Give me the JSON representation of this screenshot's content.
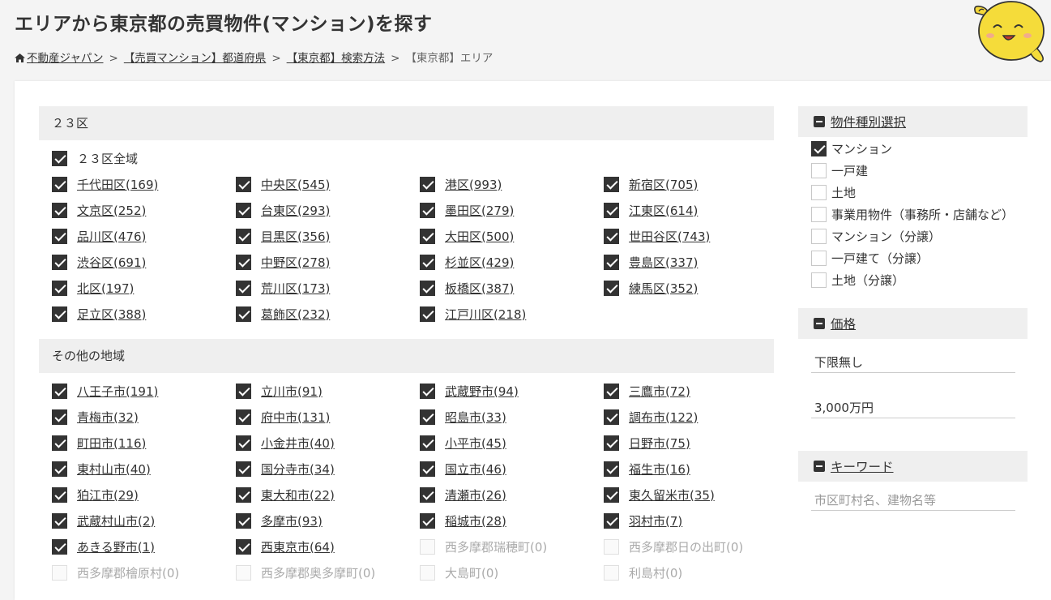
{
  "page": {
    "title": "エリアから東京都の売買物件(マンション)を探す"
  },
  "breadcrumb": {
    "items": [
      "不動産ジャパン",
      "【売買マンション】都道府県",
      "【東京都】検索方法"
    ],
    "current": "【東京都】エリア",
    "separator": ">"
  },
  "sections": {
    "wards": {
      "title": "２３区",
      "all_label": "２３区全域",
      "items": [
        {
          "label": "千代田区(169)",
          "checked": true
        },
        {
          "label": "中央区(545)",
          "checked": true
        },
        {
          "label": "港区(993)",
          "checked": true
        },
        {
          "label": "新宿区(705)",
          "checked": true
        },
        {
          "label": "文京区(252)",
          "checked": true
        },
        {
          "label": "台東区(293)",
          "checked": true
        },
        {
          "label": "墨田区(279)",
          "checked": true
        },
        {
          "label": "江東区(614)",
          "checked": true
        },
        {
          "label": "品川区(476)",
          "checked": true
        },
        {
          "label": "目黒区(356)",
          "checked": true
        },
        {
          "label": "大田区(500)",
          "checked": true
        },
        {
          "label": "世田谷区(743)",
          "checked": true
        },
        {
          "label": "渋谷区(691)",
          "checked": true
        },
        {
          "label": "中野区(278)",
          "checked": true
        },
        {
          "label": "杉並区(429)",
          "checked": true
        },
        {
          "label": "豊島区(337)",
          "checked": true
        },
        {
          "label": "北区(197)",
          "checked": true
        },
        {
          "label": "荒川区(173)",
          "checked": true
        },
        {
          "label": "板橋区(387)",
          "checked": true
        },
        {
          "label": "練馬区(352)",
          "checked": true
        },
        {
          "label": "足立区(388)",
          "checked": true
        },
        {
          "label": "葛飾区(232)",
          "checked": true
        },
        {
          "label": "江戸川区(218)",
          "checked": true
        }
      ]
    },
    "other": {
      "title": "その他の地域",
      "items": [
        {
          "label": "八王子市(191)",
          "checked": true
        },
        {
          "label": "立川市(91)",
          "checked": true
        },
        {
          "label": "武蔵野市(94)",
          "checked": true
        },
        {
          "label": "三鷹市(72)",
          "checked": true
        },
        {
          "label": "青梅市(32)",
          "checked": true
        },
        {
          "label": "府中市(131)",
          "checked": true
        },
        {
          "label": "昭島市(33)",
          "checked": true
        },
        {
          "label": "調布市(122)",
          "checked": true
        },
        {
          "label": "町田市(116)",
          "checked": true
        },
        {
          "label": "小金井市(40)",
          "checked": true
        },
        {
          "label": "小平市(45)",
          "checked": true
        },
        {
          "label": "日野市(75)",
          "checked": true
        },
        {
          "label": "東村山市(40)",
          "checked": true
        },
        {
          "label": "国分寺市(34)",
          "checked": true
        },
        {
          "label": "国立市(46)",
          "checked": true
        },
        {
          "label": "福生市(16)",
          "checked": true
        },
        {
          "label": "狛江市(29)",
          "checked": true
        },
        {
          "label": "東大和市(22)",
          "checked": true
        },
        {
          "label": "清瀬市(26)",
          "checked": true
        },
        {
          "label": "東久留米市(35)",
          "checked": true
        },
        {
          "label": "武蔵村山市(2)",
          "checked": true
        },
        {
          "label": "多摩市(93)",
          "checked": true
        },
        {
          "label": "稲城市(28)",
          "checked": true
        },
        {
          "label": "羽村市(7)",
          "checked": true
        },
        {
          "label": "あきる野市(1)",
          "checked": true
        },
        {
          "label": "西東京市(64)",
          "checked": true
        },
        {
          "label": "西多摩郡瑞穂町(0)",
          "checked": false,
          "disabled": true
        },
        {
          "label": "西多摩郡日の出町(0)",
          "checked": false,
          "disabled": true
        },
        {
          "label": "西多摩郡檜原村(0)",
          "checked": false,
          "disabled": true
        },
        {
          "label": "西多摩郡奥多摩町(0)",
          "checked": false,
          "disabled": true
        },
        {
          "label": "大島町(0)",
          "checked": false,
          "disabled": true
        },
        {
          "label": "利島村(0)",
          "checked": false,
          "disabled": true
        }
      ]
    }
  },
  "sidebar": {
    "property_type": {
      "title": "物件種別選択",
      "items": [
        {
          "label": "マンション",
          "checked": true
        },
        {
          "label": "一戸建",
          "checked": false
        },
        {
          "label": "土地",
          "checked": false
        },
        {
          "label": "事業用物件（事務所・店舗など）",
          "checked": false
        },
        {
          "label": "マンション（分譲）",
          "checked": false
        },
        {
          "label": "一戸建て（分譲）",
          "checked": false
        },
        {
          "label": "土地（分譲）",
          "checked": false
        }
      ]
    },
    "price": {
      "title": "価格",
      "min_value": "下限無し",
      "max_value": "3,000万円"
    },
    "keyword": {
      "title": "キーワード",
      "placeholder": "市区町村名、建物名等"
    }
  }
}
